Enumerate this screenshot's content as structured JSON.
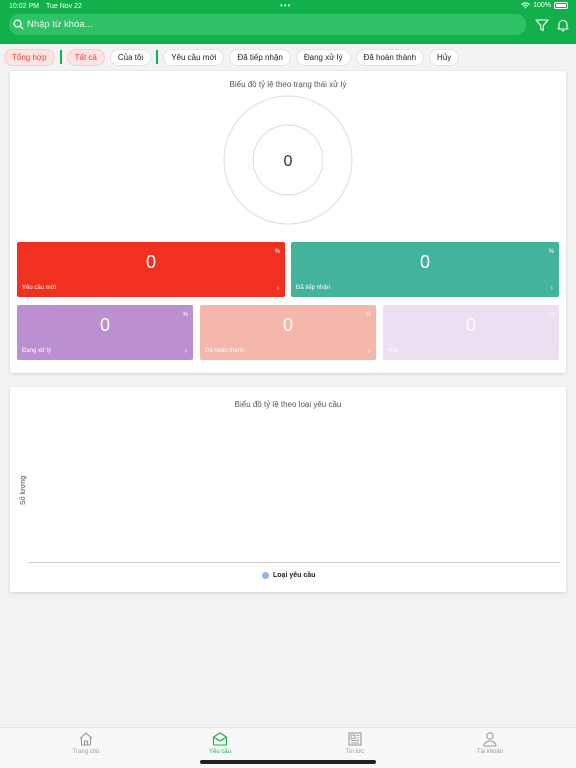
{
  "status_bar": {
    "time": "10:02 PM",
    "date": "Tue Nov 22",
    "battery": "100%"
  },
  "search": {
    "placeholder": "Nhập từ khóa..."
  },
  "tabs": [
    "Tổng hợp",
    "Tất cả",
    "Của tôi",
    "Yêu cầu mới",
    "Đã tiếp nhận",
    "Đang xử lý",
    "Đã hoàn thành",
    "Hủy"
  ],
  "status_chart": {
    "title": "Biểu đồ tỷ lệ theo trạng thái xử lý",
    "total": "0",
    "tiles": [
      {
        "label": "Yêu cầu mới",
        "value": "0",
        "unit": "%",
        "color": "#f1301f"
      },
      {
        "label": "Đã tiếp nhận",
        "value": "0",
        "unit": "%",
        "color": "#44b39b"
      },
      {
        "label": "Đang xử lý",
        "value": "0",
        "unit": "%",
        "color": "#bb8fd0"
      },
      {
        "label": "Đã hoàn thành",
        "value": "0",
        "unit": "%",
        "color": "#f5b7ac"
      },
      {
        "label": "Hủy",
        "value": "0",
        "unit": "%",
        "color": "#ebdff1"
      }
    ]
  },
  "type_chart": {
    "title": "Biểu đồ tỷ lệ theo loại yêu cầu",
    "ylabel": "Số lượng",
    "legend": "Loại yêu cầu",
    "legend_color": "#8fb5ee"
  },
  "bottom_nav": [
    {
      "label": "Trang chủ",
      "icon": "home-icon"
    },
    {
      "label": "Yêu cầu",
      "icon": "mail-icon"
    },
    {
      "label": "Tin tức",
      "icon": "news-icon"
    },
    {
      "label": "Tài khoản",
      "icon": "user-icon"
    }
  ],
  "colors": {
    "brand": "#12b04a",
    "accent_red": "#e9443a"
  }
}
